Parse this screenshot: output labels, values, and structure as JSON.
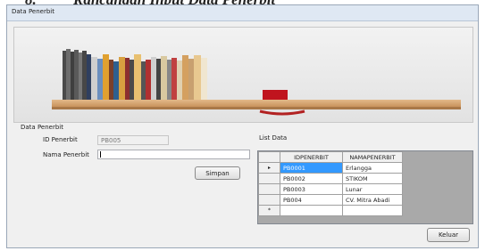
{
  "caption": {
    "number": "8.",
    "text": "Rancangan Input Data Penerbit"
  },
  "window": {
    "title": "Data Penerbit"
  },
  "form": {
    "group_label": "Data Penerbit",
    "id_label": "ID Penerbit",
    "id_value": "PB005",
    "name_label": "Nama Penerbit",
    "name_value": "",
    "save_label": "Simpan"
  },
  "list": {
    "label": "List Data",
    "columns": [
      "IDPENERBIT",
      "NAMAPENERBIT"
    ],
    "rows": [
      {
        "indicator": "▸",
        "id": "PB0001",
        "name": "Erlangga"
      },
      {
        "indicator": "",
        "id": "PB0002",
        "name": "STIKOM"
      },
      {
        "indicator": "",
        "id": "PB0003",
        "name": "Lunar"
      },
      {
        "indicator": "",
        "id": "PB004",
        "name": "CV. Mitra Abadi"
      }
    ],
    "new_row_indicator": "*"
  },
  "exit_label": "Keluar"
}
